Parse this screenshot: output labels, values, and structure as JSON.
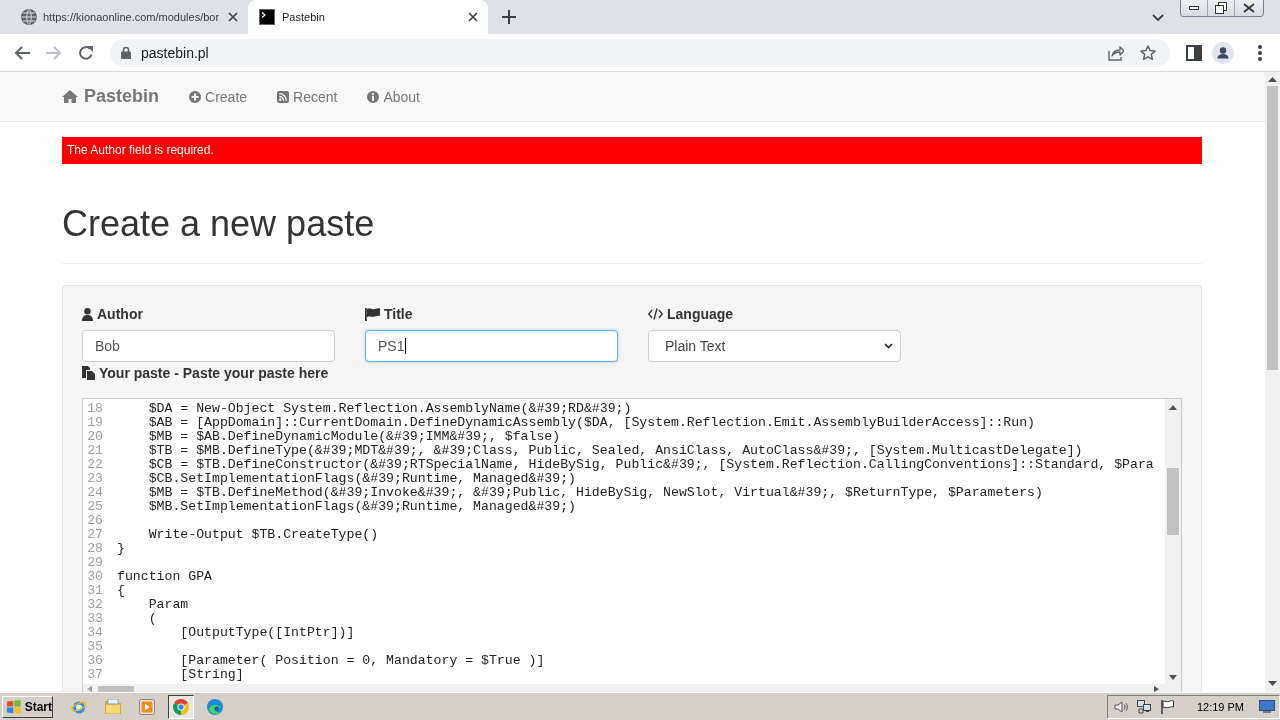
{
  "browser": {
    "tabs": [
      {
        "title": "https://kionaonline.com/modules/bor",
        "selected": false
      },
      {
        "title": "Pastebin",
        "selected": true
      }
    ],
    "address": "pastebin.pl"
  },
  "navbar": {
    "brand": "Pastebin",
    "links": [
      {
        "label": "Create"
      },
      {
        "label": "Recent"
      },
      {
        "label": "About"
      }
    ]
  },
  "alert": {
    "message": "The Author field is required."
  },
  "heading": "Create a new paste",
  "form": {
    "fields": [
      {
        "label": "Author",
        "kind": "text",
        "value": "Bob",
        "focused": false
      },
      {
        "label": "Title",
        "kind": "text",
        "value": "PS1",
        "focused": true
      },
      {
        "label": "Language",
        "kind": "select",
        "value": "Plain Text",
        "focused": false
      }
    ],
    "paste_label": "Your paste - Paste your paste here",
    "editor": {
      "lines": [
        {
          "number": "18",
          "text": "    $DA = New-Object System.Reflection.AssemblyName(&#39;RD&#39;)"
        },
        {
          "number": "19",
          "text": "    $AB = [AppDomain]::CurrentDomain.DefineDynamicAssembly($DA, [System.Reflection.Emit.AssemblyBuilderAccess]::Run)"
        },
        {
          "number": "20",
          "text": "    $MB = $AB.DefineDynamicModule(&#39;IMM&#39;, $false)"
        },
        {
          "number": "21",
          "text": "    $TB = $MB.DefineType(&#39;MDT&#39;, &#39;Class, Public, Sealed, AnsiClass, AutoClass&#39;, [System.MulticastDelegate])"
        },
        {
          "number": "22",
          "text": "    $CB = $TB.DefineConstructor(&#39;RTSpecialName, HideBySig, Public&#39;, [System.Reflection.CallingConventions]::Standard, $Para"
        },
        {
          "number": "23",
          "text": "    $CB.SetImplementationFlags(&#39;Runtime, Managed&#39;)"
        },
        {
          "number": "24",
          "text": "    $MB = $TB.DefineMethod(&#39;Invoke&#39;, &#39;Public, HideBySig, NewSlot, Virtual&#39;, $ReturnType, $Parameters)"
        },
        {
          "number": "25",
          "text": "    $MB.SetImplementationFlags(&#39;Runtime, Managed&#39;)"
        },
        {
          "number": "26"
        },
        {
          "number": "27",
          "text": "    Write-Output $TB.CreateType()"
        },
        {
          "number": "28",
          "text": "}"
        },
        {
          "number": "29"
        },
        {
          "number": "30",
          "text": "function GPA"
        },
        {
          "number": "31",
          "text": "{"
        },
        {
          "number": "32",
          "text": "    Param"
        },
        {
          "number": "33",
          "text": "    ("
        },
        {
          "number": "34",
          "text": "        [OutputType([IntPtr])]"
        },
        {
          "number": "35"
        },
        {
          "number": "36",
          "text": "        [Parameter( Position = 0, Mandatory = $True )]"
        },
        {
          "number": "37",
          "text": "        [String]"
        }
      ]
    }
  },
  "taskbar": {
    "start": "Start",
    "apps": [
      {
        "selected": false
      },
      {
        "selected": false
      },
      {
        "selected": false
      },
      {
        "selected": true
      },
      {
        "selected": false
      }
    ],
    "clock": "12:19 PM"
  }
}
